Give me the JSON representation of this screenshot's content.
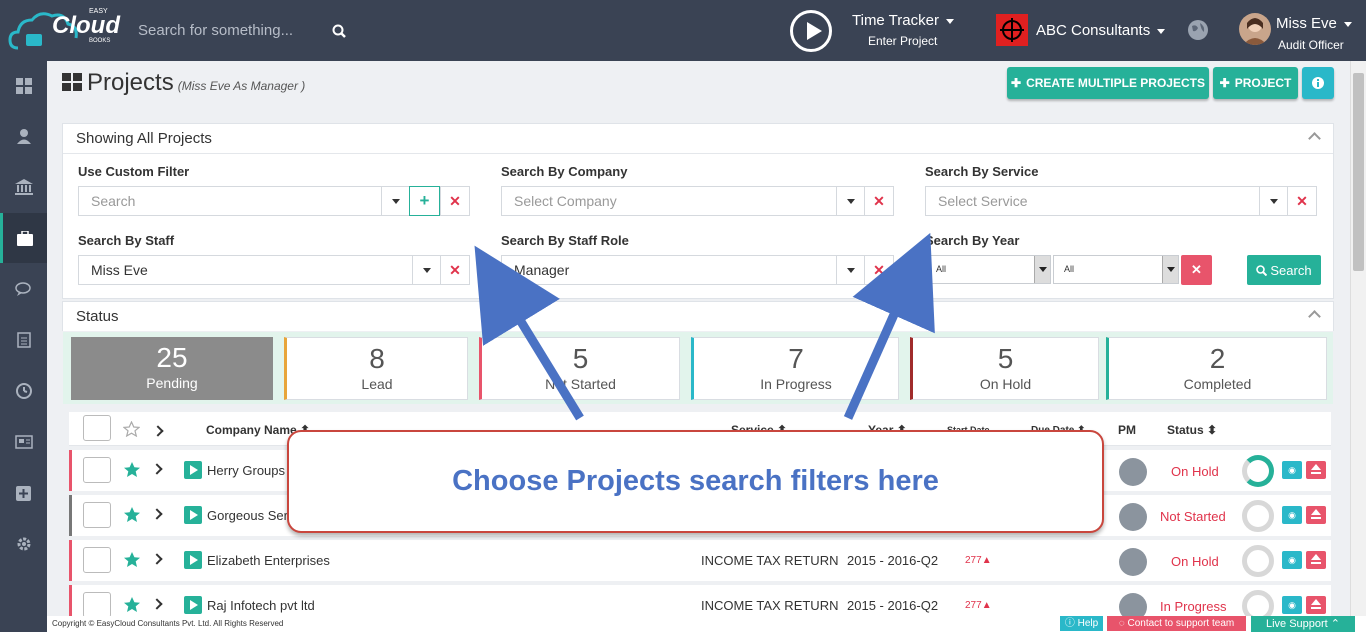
{
  "header": {
    "logo_main": "Cloud",
    "logo_top": "EASY",
    "logo_bottom": "BOOKS",
    "search_placeholder": "Search for something...",
    "time_tracker": "Time Tracker",
    "enter_project": "Enter Project",
    "organization": "ABC Consultants",
    "user_name": "Miss Eve",
    "user_role": "Audit Officer"
  },
  "sidebar": {
    "items": [
      {
        "icon": "dashboard-icon"
      },
      {
        "icon": "user-icon"
      },
      {
        "icon": "bank-icon"
      },
      {
        "icon": "briefcase-icon",
        "active": true
      },
      {
        "icon": "chat-icon"
      },
      {
        "icon": "document-icon"
      },
      {
        "icon": "clock-icon"
      },
      {
        "icon": "newspaper-icon"
      },
      {
        "icon": "plus-square-icon"
      },
      {
        "icon": "gear-icon"
      }
    ]
  },
  "page": {
    "title": "Projects",
    "subtitle": "(Miss Eve As Manager )",
    "create_multiple": "CREATE MULTIPLE PROJECTS",
    "project_button": "PROJECT"
  },
  "filters": {
    "panel_title": "Showing All Projects",
    "custom_filter_label": "Use Custom Filter",
    "custom_filter_placeholder": "Search",
    "company_label": "Search By Company",
    "company_placeholder": "Select Company",
    "service_label": "Search By Service",
    "service_placeholder": "Select Service",
    "staff_label": "Search By Staff",
    "staff_value": "Miss Eve",
    "role_label": "Search By Staff Role",
    "role_value": "Manager",
    "year_label": "Search By Year",
    "year_from": "All",
    "year_to": "All",
    "search_button": "Search"
  },
  "status": {
    "panel_title": "Status",
    "cards": [
      {
        "count": "25",
        "label": "Pending",
        "color": "#8b8b8b"
      },
      {
        "count": "8",
        "label": "Lead",
        "color": "#e8a53a"
      },
      {
        "count": "5",
        "label": "Not Started",
        "color": "#e8546b"
      },
      {
        "count": "7",
        "label": "In Progress",
        "color": "#2ab8c9"
      },
      {
        "count": "5",
        "label": "On Hold",
        "color": "#a02b2b"
      },
      {
        "count": "2",
        "label": "Completed",
        "color": "#26b199"
      }
    ]
  },
  "table": {
    "columns": {
      "company": "Company Name",
      "service": "Service",
      "year": "Year",
      "start": "Start Date",
      "due": "Due Date",
      "pm": "PM",
      "status": "Status"
    },
    "rows": [
      {
        "company": "Herry Groups Pvt Ltd",
        "service": "",
        "year": "",
        "due": "",
        "status": "On Hold"
      },
      {
        "company": "Gorgeous Services",
        "service": "",
        "year": "",
        "due": "",
        "status": "Not Started"
      },
      {
        "company": "Elizabeth Enterprises",
        "service": "INCOME TAX RETURN",
        "year": "2015 - 2016-Q2",
        "due": "277",
        "status": "On Hold"
      },
      {
        "company": "Raj Infotech pvt ltd",
        "service": "INCOME TAX RETURN",
        "year": "2015 - 2016-Q2",
        "due": "277",
        "status": "In Progress"
      }
    ]
  },
  "callout": {
    "text": "Choose Projects search filters here"
  },
  "footer": {
    "copyright": "Copyright © EasyCloud Consultants Pvt. Ltd. All Rights Reserved",
    "help": "Help",
    "contact": "Contact to support team",
    "live_support": "Live Support"
  },
  "colors": {
    "accent": "#26b199",
    "danger": "#e8546b",
    "info": "#2ab8c9",
    "topbar": "#3a4354"
  }
}
